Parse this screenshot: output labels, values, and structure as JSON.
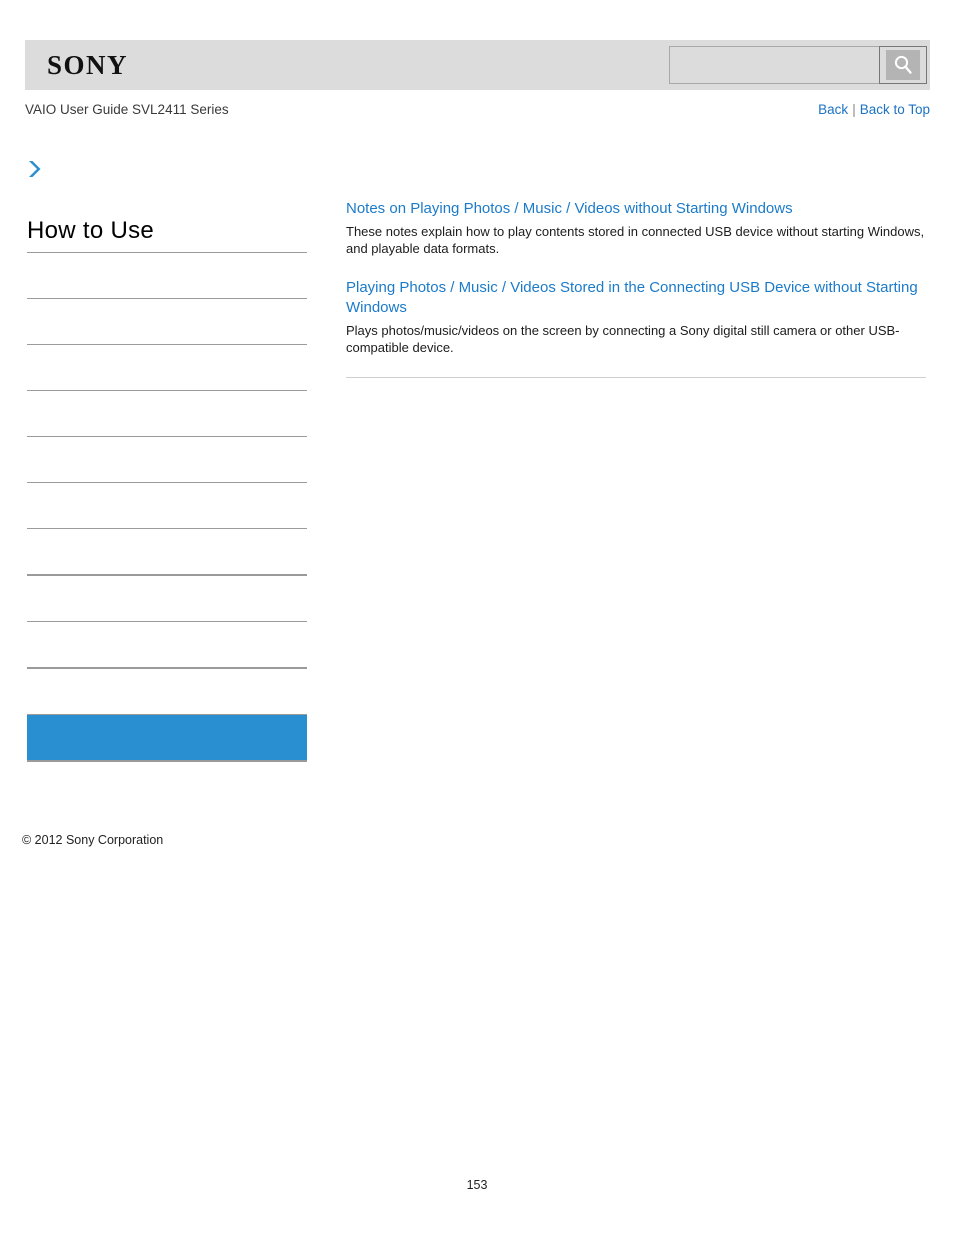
{
  "header": {
    "logo_text": "SONY",
    "search": {
      "value": "",
      "placeholder": "",
      "icon": "search-icon",
      "button_label": ""
    }
  },
  "subheader": {
    "guide_title": "VAIO User Guide SVL2411 Series",
    "back_label": "Back",
    "separator": "|",
    "back_to_top_label": "Back to Top"
  },
  "sidebar": {
    "chevron_icon": "chevron-right-icon",
    "heading": "How to Use",
    "accent_color": "#2a8fd0",
    "items": [
      {
        "label": ""
      },
      {
        "label": ""
      },
      {
        "label": ""
      },
      {
        "label": ""
      },
      {
        "label": ""
      },
      {
        "label": ""
      },
      {
        "label": ""
      },
      {
        "label": ""
      },
      {
        "label": ""
      },
      {
        "label": ""
      },
      {
        "label": "",
        "selected": true
      }
    ],
    "copyright": "© 2012 Sony Corporation"
  },
  "main": {
    "entries": [
      {
        "link": "Notes on Playing Photos / Music / Videos without Starting Windows",
        "description": "These notes explain how to play contents stored in connected USB device without starting Windows, and playable data formats."
      },
      {
        "link": "Playing Photos / Music / Videos Stored in the Connecting USB Device without Starting Windows",
        "description": "Plays photos/music/videos on the screen by connecting a Sony digital still camera or other USB-compatible device."
      }
    ]
  },
  "footer": {
    "page_number": "153"
  }
}
